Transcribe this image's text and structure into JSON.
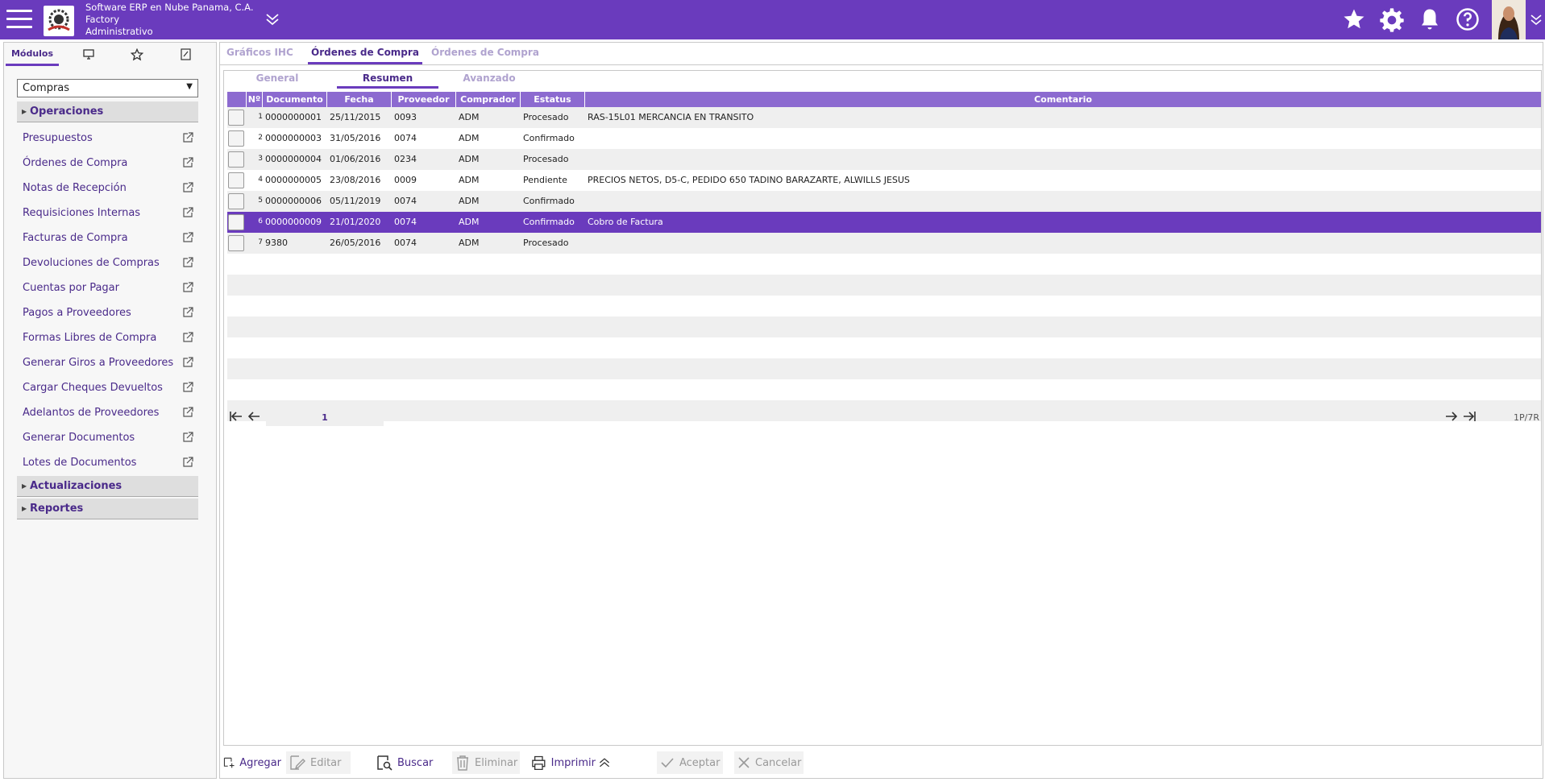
{
  "header": {
    "company": "Software ERP en Nube Panama, C.A.",
    "branch": "Factory",
    "role": "Administrativo",
    "icons": [
      "menu-icon",
      "chevron-down-icon",
      "star-icon",
      "gear-icon",
      "bell-icon",
      "help-icon"
    ]
  },
  "sidebar": {
    "tabs": [
      "Módulos",
      "monitor-icon",
      "star-icon",
      "edit-icon"
    ],
    "module_selected": "Compras",
    "sections": {
      "operaciones": "Operaciones",
      "actualizaciones": "Actualizaciones",
      "reportes": "Reportes"
    },
    "items": [
      "Presupuestos",
      "Órdenes de Compra",
      "Notas de Recepción",
      "Requisiciones Internas",
      "Facturas de Compra",
      "Devoluciones de Compras",
      "Cuentas por Pagar",
      "Pagos a Proveedores",
      "Formas Libres de Compra",
      "Generar Giros a Proveedores",
      "Cargar Cheques Devueltos",
      "Adelantos de Proveedores",
      "Generar Documentos",
      "Lotes de Documentos"
    ]
  },
  "main": {
    "tabs": [
      "Gráficos IHC",
      "Órdenes de Compra",
      "Órdenes de Compra"
    ],
    "subtabs": [
      "General",
      "Resumen",
      "Avanzado"
    ],
    "columns": [
      "Nº",
      "Documento",
      "Fecha",
      "Proveedor",
      "Comprador",
      "Estatus",
      "Comentario"
    ],
    "rows": [
      {
        "n": "1",
        "doc": "0000000001",
        "fecha": "25/11/2015",
        "prov": "0093",
        "comp": "ADM",
        "estatus": "Procesado",
        "coment": "RAS-15L01 MERCANCIA EN TRANSITO"
      },
      {
        "n": "2",
        "doc": "0000000003",
        "fecha": "31/05/2016",
        "prov": "0074",
        "comp": "ADM",
        "estatus": "Confirmado",
        "coment": ""
      },
      {
        "n": "3",
        "doc": "0000000004",
        "fecha": "01/06/2016",
        "prov": "0234",
        "comp": "ADM",
        "estatus": "Procesado",
        "coment": ""
      },
      {
        "n": "4",
        "doc": "0000000005",
        "fecha": "23/08/2016",
        "prov": "0009",
        "comp": "ADM",
        "estatus": "Pendiente",
        "coment": "PRECIOS NETOS, D5-C, PEDIDO 650 TADINO BARAZARTE, ALWILLS JESUS"
      },
      {
        "n": "5",
        "doc": "0000000006",
        "fecha": "05/11/2019",
        "prov": "0074",
        "comp": "ADM",
        "estatus": "Confirmado",
        "coment": ""
      },
      {
        "n": "6",
        "doc": "0000000009",
        "fecha": "21/01/2020",
        "prov": "0074",
        "comp": "ADM",
        "estatus": "Confirmado",
        "coment": "Cobro de Factura"
      },
      {
        "n": "7",
        "doc": "9380",
        "fecha": "26/05/2016",
        "prov": "0074",
        "comp": "ADM",
        "estatus": "Procesado",
        "coment": ""
      }
    ],
    "selected_row": 6,
    "pager": {
      "page": "1",
      "info": "1P/7R"
    },
    "toolbar": {
      "agregar": "Agregar",
      "editar": "Editar",
      "buscar": "Buscar",
      "eliminar": "Eliminar",
      "imprimir": "Imprimir",
      "aceptar": "Aceptar",
      "cancelar": "Cancelar"
    }
  },
  "colors": {
    "accent": "#6a3bbd",
    "header_grid": "#8c6ad0",
    "link": "#4a2a8a"
  }
}
